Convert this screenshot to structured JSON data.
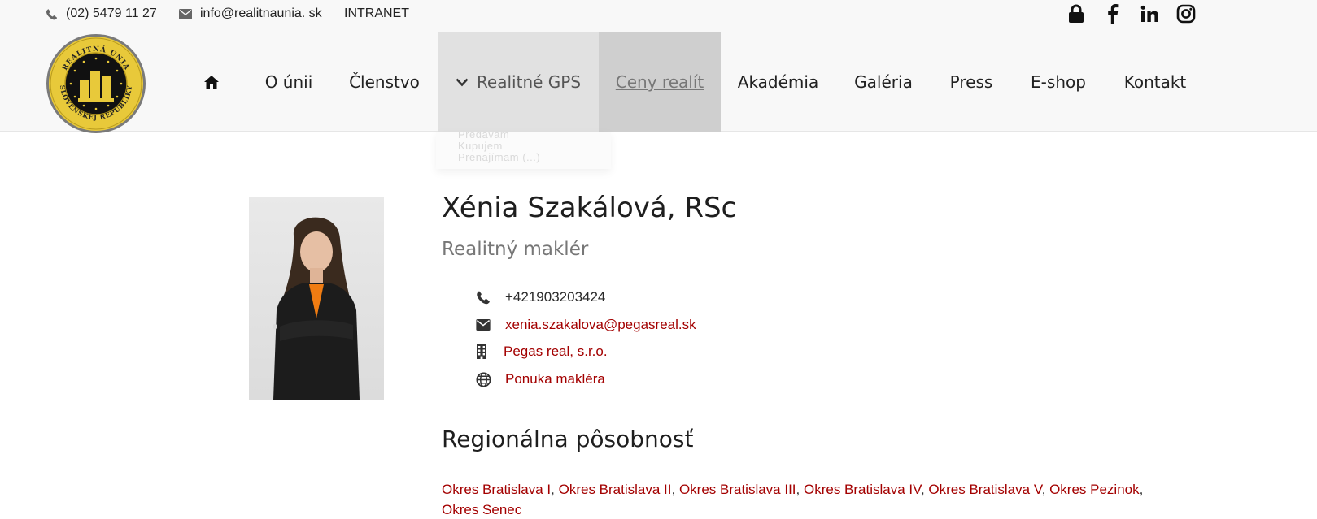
{
  "topbar": {
    "phone": "(02) 5479 11 27",
    "email": "info@realitnaunia. sk",
    "intranet": "INTRANET",
    "social_icons": [
      "lock-icon",
      "facebook-icon",
      "linkedin-icon",
      "instagram-icon"
    ]
  },
  "logo": {
    "top_text": "REALITNÁ ÚNIA",
    "bottom_text": "SLOVENSKEJ REPUBLIKY"
  },
  "nav": {
    "home_icon": "home-icon",
    "items": [
      {
        "label": "O únii"
      },
      {
        "label": "Členstvo"
      },
      {
        "label": "Realitné GPS",
        "state": "open"
      },
      {
        "label": "Ceny realít",
        "state": "hover"
      },
      {
        "label": "Akadémia"
      },
      {
        "label": "Galéria"
      },
      {
        "label": "Press"
      },
      {
        "label": "E-shop"
      },
      {
        "label": "Kontakt"
      }
    ],
    "dropdown": [
      "Predávam",
      "Kupujem",
      "Prenajímam (...)"
    ]
  },
  "profile": {
    "name": "Xénia Szakálová, RSc",
    "role": "Realitný maklér",
    "contacts": {
      "phone": "+421903203424",
      "email": "xenia.szakalova@pegasreal.sk",
      "company": "Pegas real, s.r.o.",
      "offer": "Ponuka makléra"
    }
  },
  "region": {
    "title": "Regionálna pôsobnosť",
    "items": [
      "Okres Bratislava I",
      "Okres Bratislava II",
      "Okres Bratislava III",
      "Okres Bratislava IV",
      "Okres Bratislava V",
      "Okres Pezinok",
      "Okres Senec"
    ],
    "separator": ", "
  },
  "colors": {
    "link": "#a30000",
    "nav_bg": "#f8f8f8",
    "gps_bg": "#e1e1e1",
    "ceny_bg": "#cfcfcf",
    "logo_gold": "#e8c93a"
  }
}
